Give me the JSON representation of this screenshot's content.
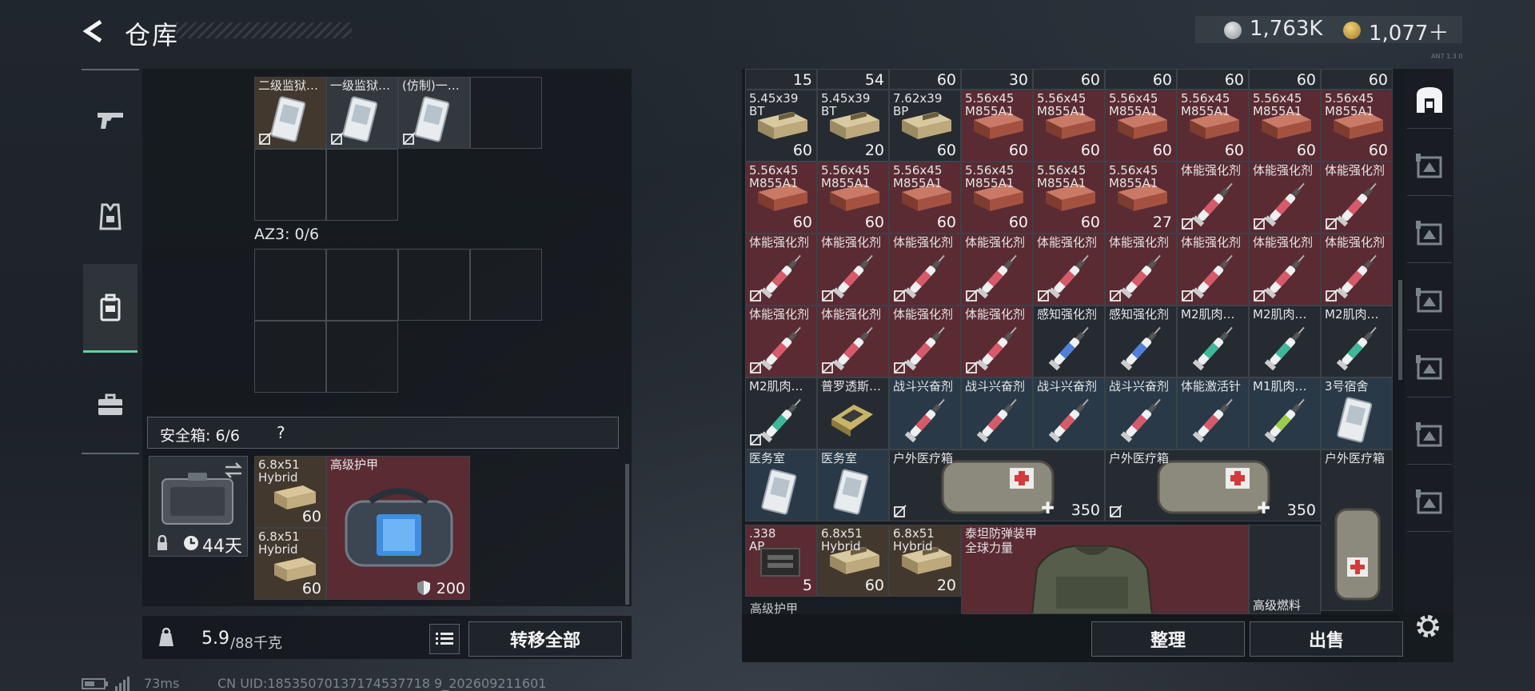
{
  "header": {
    "title": "仓库",
    "currency_primary": "1,763K",
    "currency_secondary": "1,077＋",
    "corner_text": "AN7 1.3 0"
  },
  "left": {
    "az3_label": "AZ3: 0/6",
    "safe_box_label": "安全箱: 6/6",
    "safe_box_help": "?",
    "safe_box_days": "44天",
    "top_items": [
      {
        "name": "二级监狱…",
        "color": "brown"
      },
      {
        "name": "一级监狱…",
        "color": "gray"
      },
      {
        "name": "(仿制)一…",
        "color": "gray"
      }
    ],
    "safe_items": [
      {
        "name": "6.8x51\nHybrid",
        "qty": "60"
      },
      {
        "name": "6.8x51\nHybrid",
        "qty": "60"
      }
    ],
    "armor": {
      "name": "高级护甲",
      "durability": "200"
    },
    "weight_current": "5.9",
    "weight_max": "/88千克",
    "transfer_all": "转移全部"
  },
  "right": {
    "top_quantities": [
      "15",
      "54",
      "60",
      "30",
      "60",
      "60",
      "60",
      "60",
      "60"
    ],
    "rows": [
      [
        {
          "name": "5.45x39\nBT",
          "qty": "60",
          "color": "dark",
          "icon": "ammo-tan"
        },
        {
          "name": "5.45x39\nBT",
          "qty": "20",
          "color": "dark",
          "icon": "ammo-tan"
        },
        {
          "name": "7.62x39\nBP",
          "qty": "60",
          "color": "dark",
          "icon": "ammo-tan"
        },
        {
          "name": "5.56x45\nM855A1",
          "qty": "60",
          "color": "red",
          "icon": "ammo-red"
        },
        {
          "name": "5.56x45\nM855A1",
          "qty": "60",
          "color": "red",
          "icon": "ammo-red"
        },
        {
          "name": "5.56x45\nM855A1",
          "qty": "60",
          "color": "red",
          "icon": "ammo-red"
        },
        {
          "name": "5.56x45\nM855A1",
          "qty": "60",
          "color": "red",
          "icon": "ammo-red"
        },
        {
          "name": "5.56x45\nM855A1",
          "qty": "60",
          "color": "red",
          "icon": "ammo-red"
        },
        {
          "name": "5.56x45\nM855A1",
          "qty": "60",
          "color": "red",
          "icon": "ammo-red"
        }
      ],
      [
        {
          "name": "5.56x45\nM855A1",
          "qty": "60",
          "color": "red",
          "icon": "ammo-red"
        },
        {
          "name": "5.56x45\nM855A1",
          "qty": "60",
          "color": "red",
          "icon": "ammo-red"
        },
        {
          "name": "5.56x45\nM855A1",
          "qty": "60",
          "color": "red",
          "icon": "ammo-red"
        },
        {
          "name": "5.56x45\nM855A1",
          "qty": "60",
          "color": "red",
          "icon": "ammo-red"
        },
        {
          "name": "5.56x45\nM855A1",
          "qty": "60",
          "color": "red",
          "icon": "ammo-red"
        },
        {
          "name": "5.56x45\nM855A1",
          "qty": "27",
          "color": "red",
          "icon": "ammo-red"
        },
        {
          "name": "体能强化剂",
          "qty": "",
          "color": "red",
          "icon": "syringe-red",
          "nt": true
        },
        {
          "name": "体能强化剂",
          "qty": "",
          "color": "red",
          "icon": "syringe-red",
          "nt": true
        },
        {
          "name": "体能强化剂",
          "qty": "",
          "color": "red",
          "icon": "syringe-red",
          "nt": true
        }
      ],
      [
        {
          "name": "体能强化剂",
          "qty": "",
          "color": "red",
          "icon": "syringe-red",
          "nt": true
        },
        {
          "name": "体能强化剂",
          "qty": "",
          "color": "red",
          "icon": "syringe-red",
          "nt": true
        },
        {
          "name": "体能强化剂",
          "qty": "",
          "color": "red",
          "icon": "syringe-red",
          "nt": true
        },
        {
          "name": "体能强化剂",
          "qty": "",
          "color": "red",
          "icon": "syringe-red",
          "nt": true
        },
        {
          "name": "体能强化剂",
          "qty": "",
          "color": "red",
          "icon": "syringe-red",
          "nt": true
        },
        {
          "name": "体能强化剂",
          "qty": "",
          "color": "red",
          "icon": "syringe-red",
          "nt": true
        },
        {
          "name": "体能强化剂",
          "qty": "",
          "color": "red",
          "icon": "syringe-red",
          "nt": true
        },
        {
          "name": "体能强化剂",
          "qty": "",
          "color": "red",
          "icon": "syringe-red",
          "nt": true
        },
        {
          "name": "体能强化剂",
          "qty": "",
          "color": "red",
          "icon": "syringe-red",
          "nt": true
        }
      ],
      [
        {
          "name": "体能强化剂",
          "qty": "",
          "color": "red",
          "icon": "syringe-red",
          "nt": true
        },
        {
          "name": "体能强化剂",
          "qty": "",
          "color": "red",
          "icon": "syringe-red",
          "nt": true
        },
        {
          "name": "体能强化剂",
          "qty": "",
          "color": "red",
          "icon": "syringe-red",
          "nt": true
        },
        {
          "name": "体能强化剂",
          "qty": "",
          "color": "red",
          "icon": "syringe-red",
          "nt": true
        },
        {
          "name": "感知强化剂",
          "qty": "",
          "color": "dark",
          "icon": "syringe-blue",
          "nt": false
        },
        {
          "name": "感知强化剂",
          "qty": "",
          "color": "dark",
          "icon": "syringe-blue",
          "nt": false
        },
        {
          "name": "M2肌肉…",
          "qty": "",
          "color": "dark",
          "icon": "syringe-teal",
          "nt": false
        },
        {
          "name": "M2肌肉…",
          "qty": "",
          "color": "dark",
          "icon": "syringe-teal",
          "nt": false
        },
        {
          "name": "M2肌肉…",
          "qty": "",
          "color": "dark",
          "icon": "syringe-teal",
          "nt": false
        }
      ],
      [
        {
          "name": "M2肌肉…",
          "qty": "",
          "color": "dark",
          "icon": "syringe-teal",
          "nt": true
        },
        {
          "name": "普罗透斯…",
          "qty": "",
          "color": "dark",
          "icon": "chip",
          "nt": false
        },
        {
          "name": "战斗兴奋剂",
          "qty": "",
          "color": "blue",
          "icon": "syringe-red",
          "nt": false
        },
        {
          "name": "战斗兴奋剂",
          "qty": "",
          "color": "blue",
          "icon": "syringe-red",
          "nt": false
        },
        {
          "name": "战斗兴奋剂",
          "qty": "",
          "color": "blue",
          "icon": "syringe-red",
          "nt": false
        },
        {
          "name": "战斗兴奋剂",
          "qty": "",
          "color": "blue",
          "icon": "syringe-red",
          "nt": false
        },
        {
          "name": "体能激活针",
          "qty": "",
          "color": "blue",
          "icon": "syringe-red",
          "nt": false
        },
        {
          "name": "M1肌肉…",
          "qty": "",
          "color": "blue",
          "icon": "syringe-lime",
          "nt": false
        },
        {
          "name": "3号宿舍",
          "qty": "",
          "color": "blue",
          "icon": "card",
          "nt": false
        }
      ]
    ],
    "medkit_row": {
      "small": [
        {
          "name": "医务室",
          "color": "blue",
          "icon": "card"
        },
        {
          "name": "医务室",
          "color": "blue",
          "icon": "card"
        }
      ],
      "big": [
        {
          "name": "户外医疗箱",
          "hp": "350"
        },
        {
          "name": "户外医疗箱",
          "hp": "350"
        }
      ],
      "tall": {
        "name": "户外医疗箱"
      }
    },
    "bottom_row": [
      {
        "name": ".338\nAP",
        "qty": "5",
        "color": "red",
        "icon": "mag"
      },
      {
        "name": "6.8x51\nHybrid",
        "qty": "60",
        "color": "brown",
        "icon": "ammo-tan"
      },
      {
        "name": "6.8x51\nHybrid",
        "qty": "20",
        "color": "brown",
        "icon": "ammo-tan"
      }
    ],
    "titan_armor": {
      "line1": "泰坦防弹装甲",
      "line2": "全球力量"
    },
    "partial_labels": [
      "高级护甲",
      "高级燃料"
    ],
    "sort_button": "整理",
    "sell_button": "出售"
  },
  "footer": {
    "ping": "73ms",
    "uid": "CN UID:18535070137174537718 9_202609211601"
  }
}
